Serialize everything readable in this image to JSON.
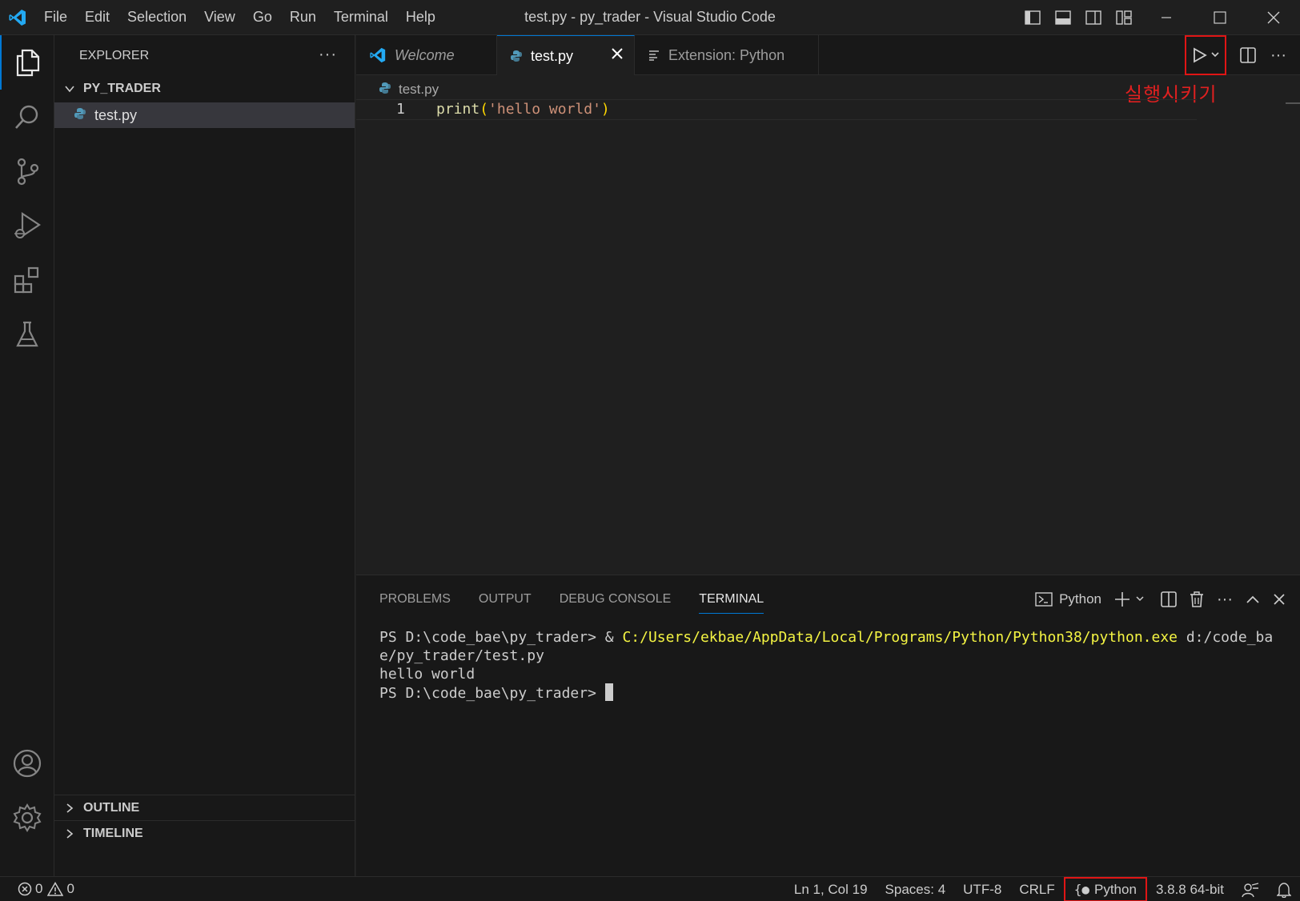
{
  "titlebar": {
    "menu": [
      "File",
      "Edit",
      "Selection",
      "View",
      "Go",
      "Run",
      "Terminal",
      "Help"
    ],
    "title": "test.py - py_trader - Visual Studio Code"
  },
  "sidebar": {
    "header": "EXPLORER",
    "folder": "PY_TRADER",
    "files": [
      "test.py"
    ],
    "sections": [
      "OUTLINE",
      "TIMELINE"
    ]
  },
  "tabs": [
    {
      "label": "Welcome",
      "icon": "vscode-icon"
    },
    {
      "label": "test.py",
      "icon": "python-icon",
      "active": true
    },
    {
      "label": "Extension: Python",
      "icon": "preview-icon"
    }
  ],
  "editor": {
    "breadcrumb": "test.py",
    "annotation": "실행시키기",
    "lines": [
      {
        "number": "1",
        "fn": "print",
        "open": "(",
        "str": "'hello world'",
        "close": ")"
      }
    ]
  },
  "panel": {
    "tabs": [
      "PROBLEMS",
      "OUTPUT",
      "DEBUG CONSOLE",
      "TERMINAL"
    ],
    "active_tab": "TERMINAL",
    "terminal_name": "Python",
    "terminal": {
      "prompt1": "PS D:\\code_bae\\py_trader> & ",
      "exe_path": "C:/Users/ekbae/AppData/Local/Programs/Python/Python38/python.exe",
      "arg": " d:/code_bae/py_trader/test.py",
      "output": "hello world",
      "prompt2": "PS D:\\code_bae\\py_trader> "
    }
  },
  "statusbar": {
    "errors": "0",
    "warnings": "0",
    "position": "Ln 1, Col 19",
    "spaces": "Spaces: 4",
    "encoding": "UTF-8",
    "eol": "CRLF",
    "language": "Python",
    "interpreter": "3.8.8 64-bit"
  },
  "colors": {
    "accent": "#0078d4",
    "highlight_box": "#e01515",
    "annotation": "#e02020"
  }
}
